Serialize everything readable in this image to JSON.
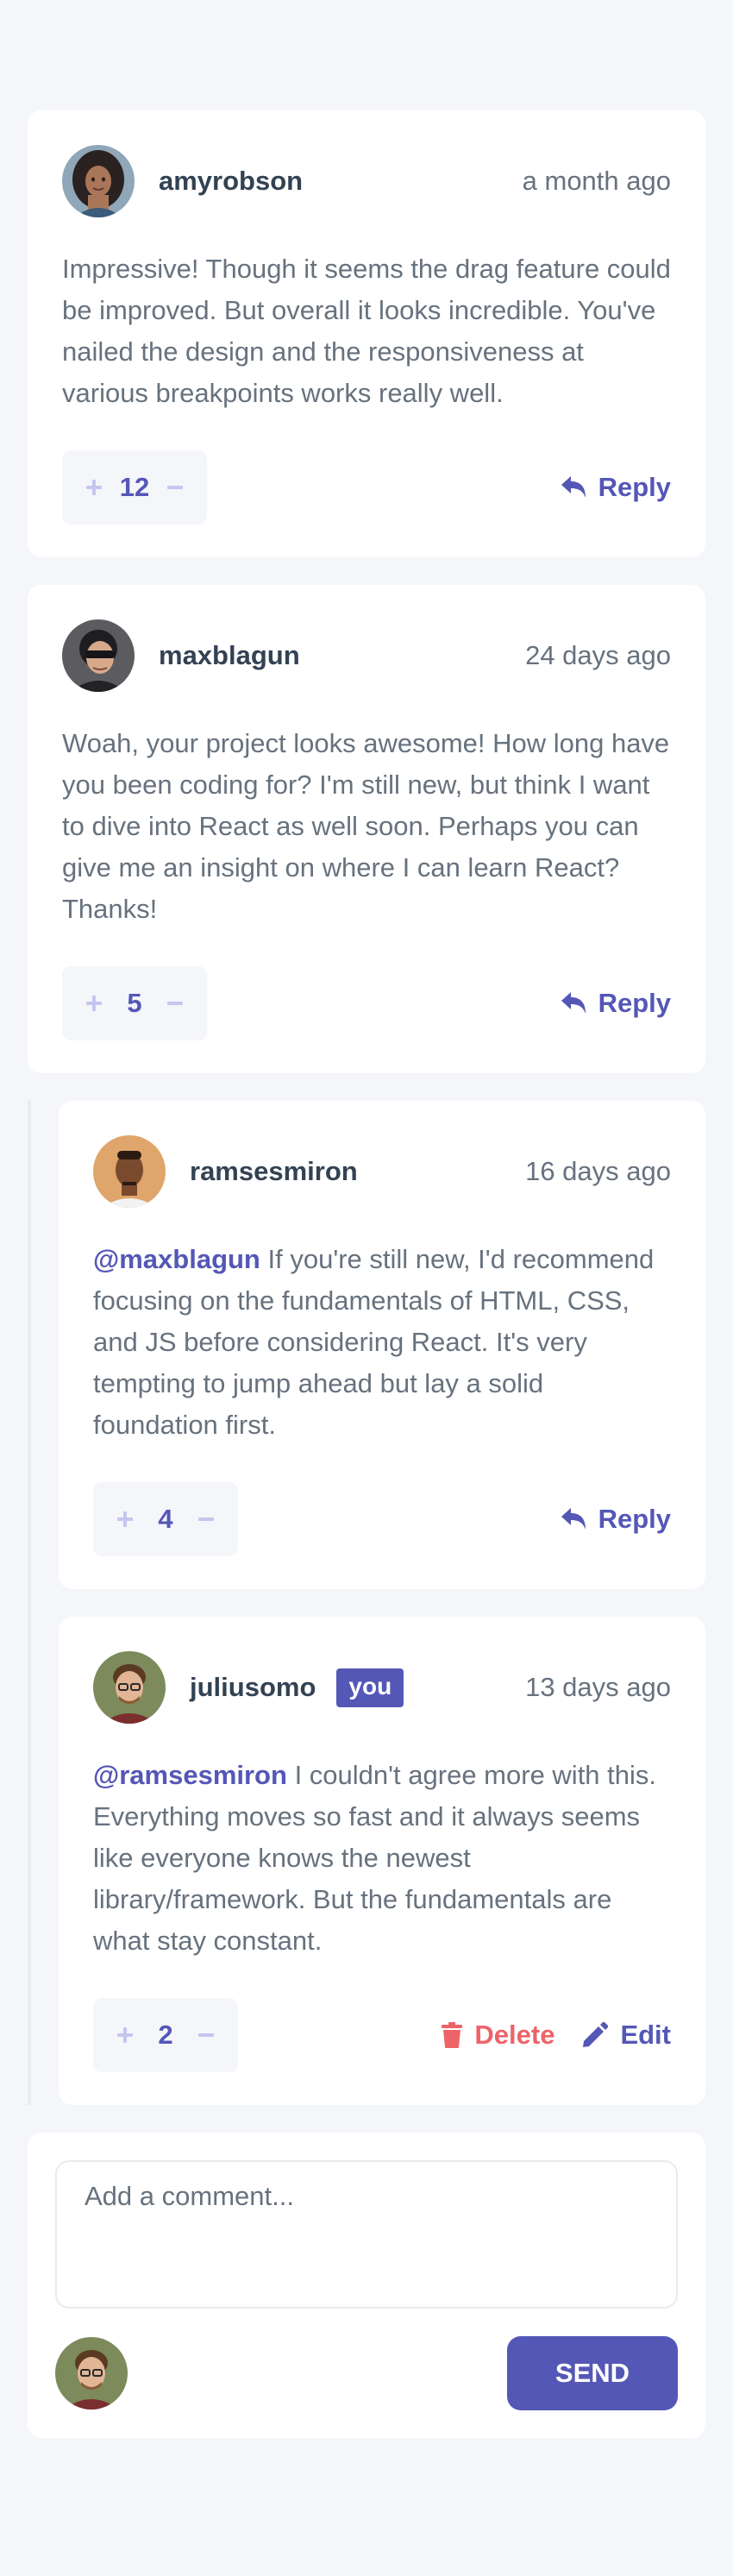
{
  "colors": {
    "primary": "#5457b6",
    "primary_light": "#c5c6ef",
    "danger": "#ed6368",
    "dark_text": "#334253",
    "muted_text": "#67727e",
    "background": "#f5f6fa",
    "card": "#ffffff"
  },
  "comments": [
    {
      "username": "amyrobson",
      "timestamp": "a month ago",
      "content": "Impressive! Though it seems the drag feature could be improved. But overall it looks incredible. You've nailed the design and the responsiveness at various breakpoints works really well.",
      "score": "12",
      "avatar_icon": "avatar-amyrobson",
      "reply_label": "Reply",
      "upvote_icon": "plus-icon",
      "downvote_icon": "minus-icon",
      "reply_icon": "reply-icon"
    },
    {
      "username": "maxblagun",
      "timestamp": "24 days ago",
      "content": "Woah, your project looks awesome! How long have you been coding for? I'm still new, but think I want to dive into React as well soon. Perhaps you can give me an insight on where I can learn React? Thanks!",
      "score": "5",
      "avatar_icon": "avatar-maxblagun",
      "reply_label": "Reply",
      "upvote_icon": "plus-icon",
      "downvote_icon": "minus-icon",
      "reply_icon": "reply-icon",
      "replies": [
        {
          "username": "ramsesmiron",
          "timestamp": "16 days ago",
          "replying_to": "@maxblagun",
          "content": "If you're still new, I'd recommend focusing on the fundamentals of HTML, CSS, and JS before considering React. It's very tempting to jump ahead but lay a solid foundation first.",
          "score": "4",
          "avatar_icon": "avatar-ramsesmiron",
          "reply_label": "Reply",
          "upvote_icon": "plus-icon",
          "downvote_icon": "minus-icon",
          "reply_icon": "reply-icon"
        },
        {
          "username": "juliusomo",
          "you_badge": "you",
          "timestamp": "13 days ago",
          "replying_to": "@ramsesmiron",
          "content": "I couldn't agree more with this. Everything moves so fast and it always seems like everyone knows the newest library/framework. But the fundamentals are what stay constant.",
          "score": "2",
          "avatar_icon": "avatar-juliusomo",
          "delete_label": "Delete",
          "edit_label": "Edit",
          "upvote_icon": "plus-icon",
          "downvote_icon": "minus-icon",
          "delete_icon": "trash-icon",
          "edit_icon": "pencil-icon"
        }
      ]
    }
  ],
  "composer": {
    "placeholder": "Add a comment...",
    "value": "",
    "send_label": "SEND",
    "avatar_icon": "avatar-juliusomo"
  }
}
